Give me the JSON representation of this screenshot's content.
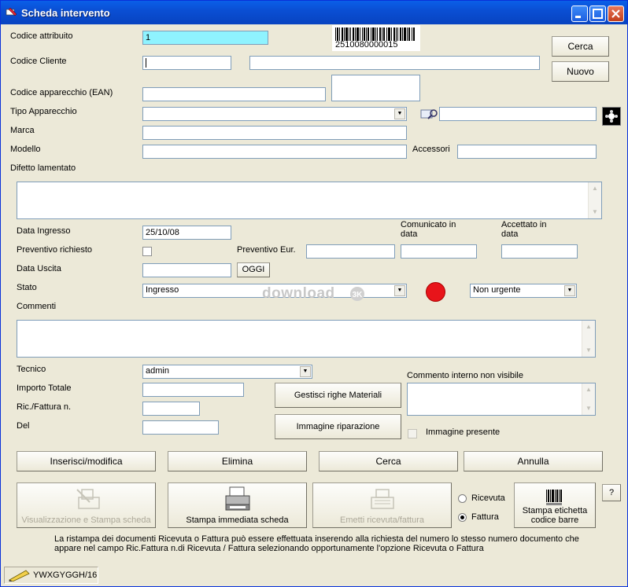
{
  "window": {
    "title": "Scheda intervento"
  },
  "labels": {
    "codice_attributo": "Codice attribuito",
    "codice_cliente": "Codice Cliente",
    "codice_apparecchio": "Codice apparecchio (EAN)",
    "tipo_apparecchio": "Tipo Apparecchio",
    "marca": "Marca",
    "modello": "Modello",
    "accessori": "Accessori",
    "difetto": "Difetto lamentato",
    "data_ingresso": "Data Ingresso",
    "comunicato": "Comunicato in data",
    "accettato": "Accettato in data",
    "preventivo_richiesto": "Preventivo richiesto",
    "preventivo_eur": "Preventivo Eur.",
    "data_uscita": "Data Uscita",
    "stato": "Stato",
    "commenti": "Commenti",
    "tecnico": "Tecnico",
    "importo_totale": "Importo Totale",
    "ric_fattura": "Ric./Fattura n.",
    "del": "Del",
    "commento_interno": "Commento interno non visibile",
    "immagine_presente": "Immagine presente"
  },
  "fields": {
    "codice_attributo": "1",
    "barcode_number": "2510080000015",
    "data_ingresso": "25/10/08",
    "stato": "Ingresso",
    "urgenza": "Non urgente",
    "tecnico": "admin"
  },
  "buttons": {
    "cerca_top": "Cerca",
    "nuovo": "Nuovo",
    "oggi": "OGGI",
    "gestisci_materiali": "Gestisci righe Materiali",
    "immagine_riparazione": "Immagine riparazione",
    "inserisci": "Inserisci/modifica",
    "elimina": "Elimina",
    "cerca": "Cerca",
    "annulla": "Annulla",
    "visualizzazione": "Visualizzazione e Stampa scheda",
    "stampa_immediata": "Stampa immediata scheda",
    "emetti": "Emetti ricevuta/fattura",
    "stampa_etichetta": "Stampa etichetta codice barre",
    "help": "?"
  },
  "radios": {
    "ricevuta": "Ricevuta",
    "fattura": "Fattura"
  },
  "note": "La ristampa dei documenti Ricevuta o Fattura può essere effettuata inserendo alla richiesta del numero lo stesso numero documento  che appare nel campo Ric.Fattura n.di Ricevuta / Fattura selezionando opportunamente l'opzione Ricevuta o Fattura",
  "status": {
    "user": "YWXGYGGH/16"
  },
  "watermark": "download",
  "colors": {
    "titlebar": "#0a4fd4",
    "highlight_field": "#8ff3ff",
    "status_dot": "#e8141a"
  }
}
